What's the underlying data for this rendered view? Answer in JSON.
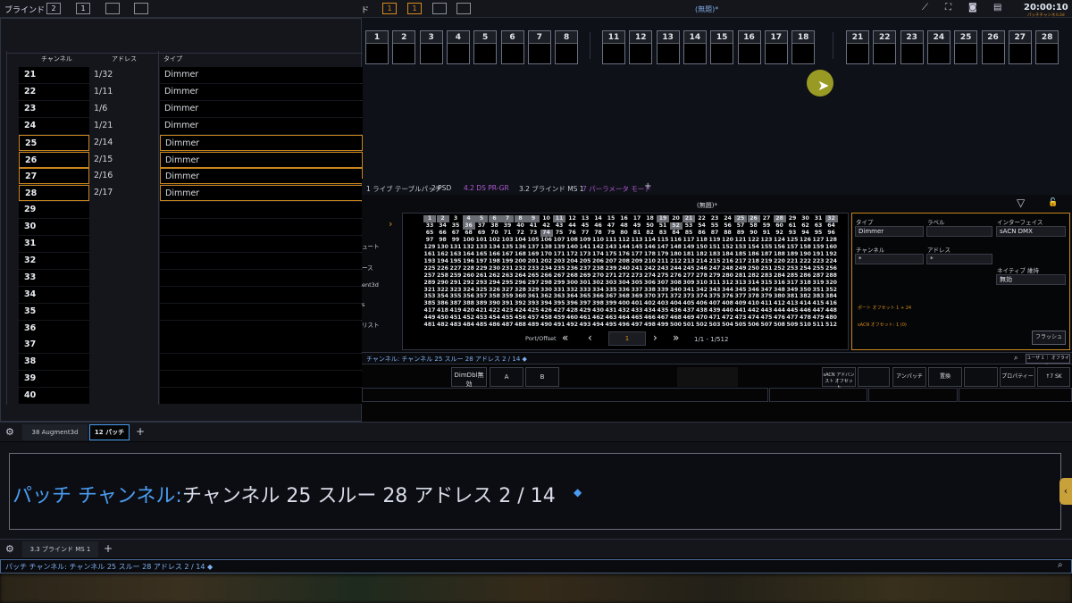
{
  "top": {
    "left_label": "ブラインド",
    "btn2": "2",
    "btn1": "1",
    "mid_label": "ド",
    "mid_btn1": "1",
    "mid_btn2": "1",
    "title": "(無題)*",
    "time": "20:00:10",
    "version": "パッチチャンネル3d"
  },
  "channel_strip": {
    "group1": [
      "1",
      "2",
      "3",
      "4",
      "5",
      "6",
      "7",
      "8"
    ],
    "group2": [
      "11",
      "12",
      "13",
      "14",
      "15",
      "16",
      "17",
      "18"
    ],
    "group3": [
      "21",
      "22",
      "23",
      "24",
      "25",
      "26",
      "27",
      "28"
    ]
  },
  "patch_table": {
    "headers": [
      "チャンネル",
      "アドレス",
      "タイプ"
    ],
    "rows": [
      {
        "ch": "21",
        "addr": "1/32",
        "type": "Dimmer"
      },
      {
        "ch": "22",
        "addr": "1/11",
        "type": "Dimmer"
      },
      {
        "ch": "23",
        "addr": "1/6",
        "type": "Dimmer"
      },
      {
        "ch": "24",
        "addr": "1/21",
        "type": "Dimmer"
      },
      {
        "ch": "25",
        "addr": "2/14",
        "type": "Dimmer"
      },
      {
        "ch": "26",
        "addr": "2/15",
        "type": "Dimmer"
      },
      {
        "ch": "27",
        "addr": "2/16",
        "type": "Dimmer"
      },
      {
        "ch": "28",
        "addr": "2/17",
        "type": "Dimmer"
      },
      {
        "ch": "29",
        "addr": "",
        "type": ""
      },
      {
        "ch": "30",
        "addr": "",
        "type": ""
      },
      {
        "ch": "31",
        "addr": "",
        "type": ""
      },
      {
        "ch": "32",
        "addr": "",
        "type": ""
      },
      {
        "ch": "33",
        "addr": "",
        "type": ""
      },
      {
        "ch": "34",
        "addr": "",
        "type": ""
      },
      {
        "ch": "35",
        "addr": "",
        "type": ""
      },
      {
        "ch": "36",
        "addr": "",
        "type": ""
      },
      {
        "ch": "37",
        "addr": "",
        "type": ""
      },
      {
        "ch": "38",
        "addr": "",
        "type": ""
      },
      {
        "ch": "39",
        "addr": "",
        "type": ""
      },
      {
        "ch": "40",
        "addr": "",
        "type": ""
      }
    ]
  },
  "mid_tabs": [
    "1 ライブ テーブルパッチ",
    "2 PSD",
    "4.2 DS PR-GR",
    "3.2 ブラインド MS 1",
    "7 パーラメータ モード",
    "+"
  ],
  "patch_title": "(無題)*",
  "side_menu": [
    "ュート",
    "ース",
    "ent3d",
    "s",
    "リスト"
  ],
  "dmx": {
    "active": [
      1,
      2,
      4,
      5,
      6,
      7,
      8,
      9,
      11,
      19,
      21,
      25,
      26,
      28,
      32,
      36,
      52,
      74
    ],
    "pager_label": "Port/Offset",
    "page": "1",
    "range": "1/1 - 1/512"
  },
  "props": {
    "type_label": "タイプ",
    "type_val": "Dimmer",
    "label_label": "ラベル",
    "iface_label": "インターフェイス",
    "iface_val": "sACN DMX",
    "ch_label": "チャンネル",
    "ch_val": "*",
    "addr_label": "アドレス",
    "addr_val": "*",
    "native_label": "ネイティブ 維持",
    "native_val": "無効",
    "info1": "ポート オフセット 1 + 24",
    "info2": "sACN オフセット: 1 (0)",
    "flash": "フラッシュ"
  },
  "mid_cmd": "チャンネル: チャンネル 25 スルー 28 アドレス 2 / 14 ◆",
  "mid_right": "ユーザ 1 ｜ オフライン",
  "soft_keys": [
    "DimDbl無効",
    "A",
    "B",
    "sACN アドバンスト オフセット",
    "アンパッチ",
    "置換",
    "プロパティー",
    "↑7 SK"
  ],
  "bottom_tabs1": [
    "38 Augment3d",
    "12 パッチ",
    "+"
  ],
  "cmd_large": {
    "prefix": "パッチ チャンネル:",
    "text": "チャンネル 25 スルー 28 アドレス 2 / 14",
    "end": "◆"
  },
  "bottom_tabs2": [
    "3.3 ブラインド MS 1",
    "+"
  ],
  "cmd_small": "パッチ チャンネル: チャンネル 25 スルー 28 アドレス 2 / 14 ◆",
  "colors": {
    "accent": "#d88a1e",
    "cmd_blue": "#4a9cf0"
  }
}
